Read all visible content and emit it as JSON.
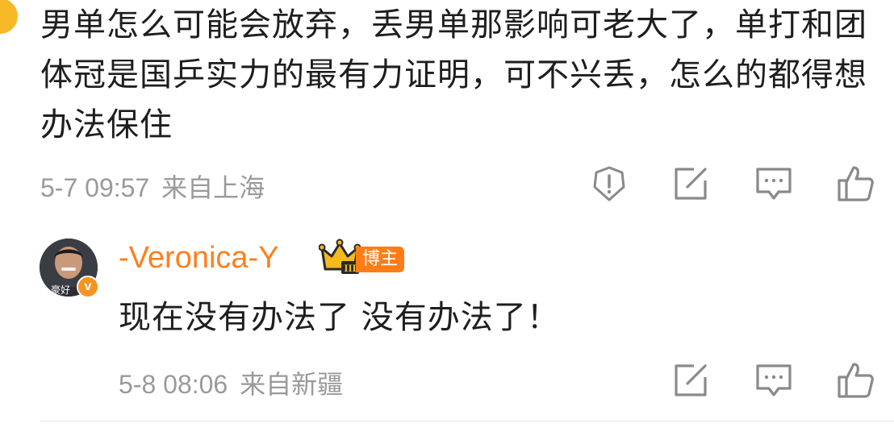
{
  "comment": {
    "text": "男单怎么可能会放弃，丢男单那影响可老大了，单打和团体冠是国乒实力的最有力证明，可不兴丢，怎么的都得想办法保住",
    "timestamp": "5-7 09:57",
    "location": "来自上海"
  },
  "reply": {
    "username": "-Veronica-Y",
    "author_tag": "博主",
    "avatar_caption": "豪好",
    "verified_badge": "v",
    "crown_level": "III",
    "text": "现在没有办法了 没有办法了！",
    "timestamp": "5-8 08:06",
    "location": "来自新疆"
  },
  "icons": {
    "report": "alert-circle-icon",
    "forward": "edit-forward-icon",
    "comment": "comment-bubble-icon",
    "like": "thumbs-up-icon"
  },
  "colors": {
    "username": "#ff7f1e",
    "author_tag": "#ff7d17",
    "meta_text": "#9a9a9a",
    "icon_stroke": "#8a8a8a",
    "text": "#1e1e1e"
  }
}
